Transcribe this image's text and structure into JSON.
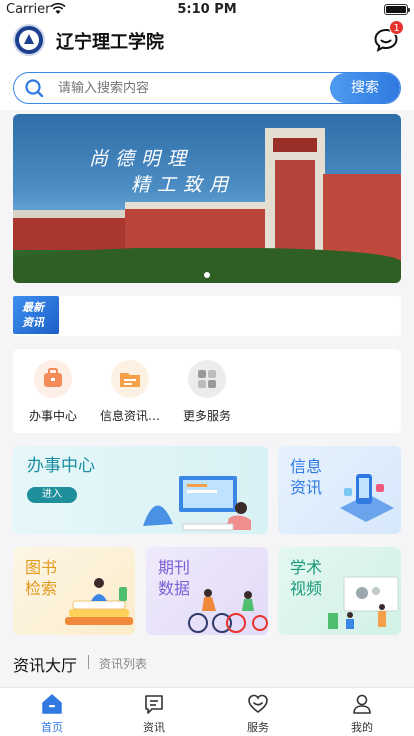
{
  "status_bar": {
    "carrier": "Carrier",
    "time": "5:10 PM"
  },
  "header": {
    "title": "辽宁理工学院",
    "message_badge": "1"
  },
  "search": {
    "placeholder": "请输入搜索内容",
    "button_label": "搜索"
  },
  "banner": {
    "calligraphy_line1": "尚德明理",
    "calligraphy_line2": "精工致用"
  },
  "news": {
    "tag": "最新资讯",
    "tag_line1": "最新",
    "tag_line2": "资讯"
  },
  "quick_services": [
    {
      "label": "办事中心",
      "icon": "briefcase-icon"
    },
    {
      "label": "信息资讯…",
      "icon": "info-folder-icon"
    },
    {
      "label": "更多服务",
      "icon": "grid-icon"
    }
  ],
  "cards": {
    "service_center": {
      "title": "办事中心",
      "button": "进入"
    },
    "info": {
      "line1": "信息",
      "line2": "资讯"
    },
    "books": {
      "line1": "图书",
      "line2": "检索"
    },
    "journals": {
      "line1": "期刊",
      "line2": "数据"
    },
    "academic": {
      "line1": "学术",
      "line2": "视频"
    }
  },
  "section": {
    "title": "资讯大厅",
    "subtitle": "资讯列表"
  },
  "tabbar": [
    {
      "label": "首页",
      "icon": "home-icon",
      "active": true
    },
    {
      "label": "资讯",
      "icon": "news-icon",
      "active": false
    },
    {
      "label": "服务",
      "icon": "service-heart-icon",
      "active": false
    },
    {
      "label": "我的",
      "icon": "user-icon",
      "active": false
    }
  ],
  "colors": {
    "accent": "#2f79e0",
    "badge": "#e8322e",
    "teal": "#1f8f9c"
  }
}
